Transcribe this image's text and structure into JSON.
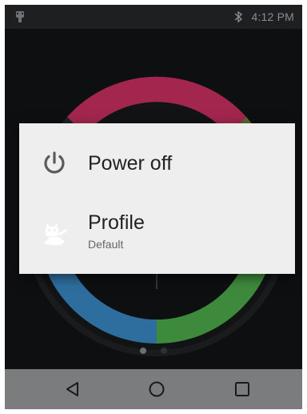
{
  "status_bar": {
    "time": "4:12 PM",
    "icons": [
      "notification-app-icon",
      "bluetooth-icon"
    ]
  },
  "background": {
    "wheel_colors": {
      "top": "#a3264f",
      "right": "#6e7a3a",
      "bottom_left": "#2d6e9e",
      "bottom_right": "#3e8a3c"
    },
    "page_indicator": {
      "count": 2,
      "active_index": 1
    }
  },
  "power_menu": {
    "items": [
      {
        "label": "Power off",
        "icon": "power-icon"
      },
      {
        "label": "Profile",
        "sublabel": "Default",
        "icon": "profile-icon"
      }
    ]
  },
  "nav_bar": {
    "buttons": [
      "back-icon",
      "home-icon",
      "recents-icon"
    ]
  }
}
